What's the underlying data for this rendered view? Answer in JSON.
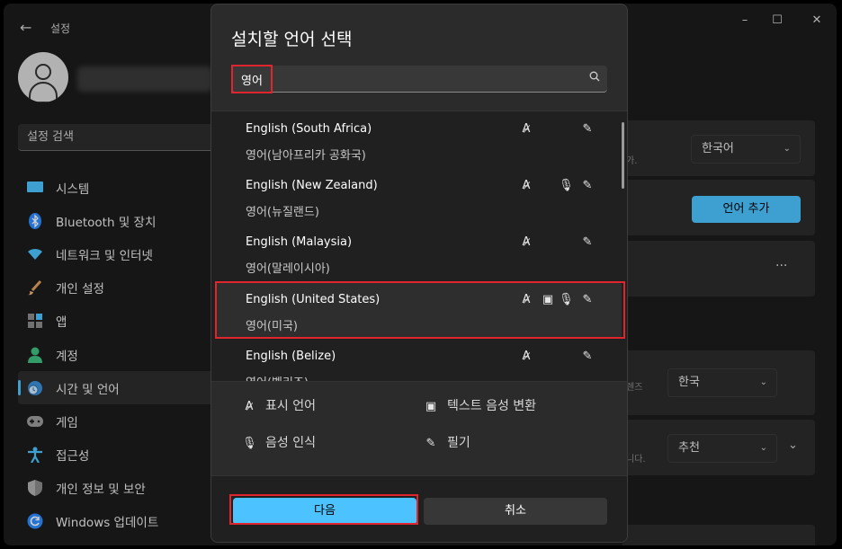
{
  "window": {
    "title": "설정",
    "back_icon": "arrow-left-icon",
    "minimize": "–",
    "maximize": "☐",
    "close": "✕"
  },
  "sidebar": {
    "search_placeholder": "설정 검색",
    "items": [
      {
        "label": "시스템",
        "icon": "monitor-icon",
        "color": "#4cc2ff"
      },
      {
        "label": "Bluetooth 및 장치",
        "icon": "bluetooth-icon",
        "color": "#2d8cff"
      },
      {
        "label": "네트워크 및 인터넷",
        "icon": "wifi-icon",
        "color": "#4cc2ff"
      },
      {
        "label": "개인 설정",
        "icon": "brush-icon",
        "color": "#f0a040"
      },
      {
        "label": "앱",
        "icon": "apps-icon",
        "color": "#a0a0a0"
      },
      {
        "label": "계정",
        "icon": "account-icon",
        "color": "#3fbf7f"
      },
      {
        "label": "시간 및 언어",
        "icon": "globe-clock-icon",
        "color": "#4cc2ff"
      },
      {
        "label": "게임",
        "icon": "gamepad-icon",
        "color": "#a0a0a0"
      },
      {
        "label": "접근성",
        "icon": "accessibility-icon",
        "color": "#4cc2ff"
      },
      {
        "label": "개인 정보 및 보안",
        "icon": "shield-icon",
        "color": "#a0a0a0"
      },
      {
        "label": "Windows 업데이트",
        "icon": "update-icon",
        "color": "#4cc2ff"
      }
    ],
    "selected_index": 6
  },
  "content": {
    "display_language_value": "한국어",
    "add_language_label": "언어 추가",
    "more_label": "···",
    "region_value": "한국",
    "format_value": "추천",
    "ghost_1": "가.",
    "ghost_2": "렌즈",
    "ghost_3": "니다."
  },
  "dialog": {
    "title": "설치할 언어 선택",
    "search_value": "영어",
    "languages": [
      {
        "name": "English (South Africa)",
        "native": "영어(남아프리카 공화국)",
        "features": [
          "display",
          "handwriting"
        ]
      },
      {
        "name": "English (New Zealand)",
        "native": "영어(뉴질랜드)",
        "features": [
          "display",
          "speech",
          "handwriting"
        ]
      },
      {
        "name": "English (Malaysia)",
        "native": "영어(말레이시아)",
        "features": [
          "display",
          "handwriting"
        ]
      },
      {
        "name": "English (United States)",
        "native": "영어(미국)",
        "features": [
          "display",
          "tts",
          "speech",
          "handwriting"
        ]
      },
      {
        "name": "English (Belize)",
        "native": "영어(벨리즈)",
        "features": [
          "display",
          "handwriting"
        ]
      }
    ],
    "selected_index": 3,
    "legend": {
      "display": "표시 언어",
      "tts": "텍스트 음성 변환",
      "speech": "음성 인식",
      "handwriting": "필기"
    },
    "next_label": "다음",
    "cancel_label": "취소"
  },
  "colors": {
    "accent": "#4cc2ff",
    "highlight": "#e0252e",
    "background": "#1c1c1c",
    "dialog": "#2b2b2b"
  }
}
